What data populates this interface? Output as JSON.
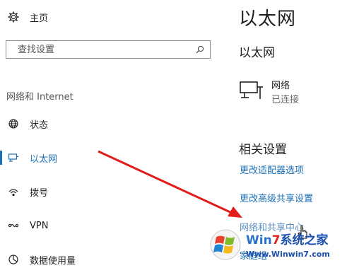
{
  "sidebar": {
    "home_label": "主页",
    "search_placeholder": "查找设置",
    "section_title": "网络和 Internet",
    "items": [
      {
        "label": "状态",
        "icon": "globe-icon"
      },
      {
        "label": "以太网",
        "icon": "ethernet-icon",
        "active": true
      },
      {
        "label": "拨号",
        "icon": "dialup-icon"
      },
      {
        "label": "VPN",
        "icon": "vpn-icon"
      },
      {
        "label": "数据使用量",
        "icon": "data-usage-icon"
      }
    ]
  },
  "main": {
    "page_title": "以太网",
    "sub_title": "以太网",
    "network": {
      "name": "网络",
      "status": "已连接",
      "icon": "ethernet-network-icon"
    },
    "related_title": "相关设置",
    "links": [
      "更改适配器选项",
      "更改高级共享设置",
      "网络和共享中心",
      "家庭组"
    ]
  },
  "watermark": {
    "line1_w": "W",
    "line1_in": "in",
    "line1_7": "7",
    "line1_cn": "系统之家",
    "line2": "Www.Winwin7.com"
  },
  "colors": {
    "accent": "#1a6fb6",
    "arrow": "#e21b1b"
  }
}
